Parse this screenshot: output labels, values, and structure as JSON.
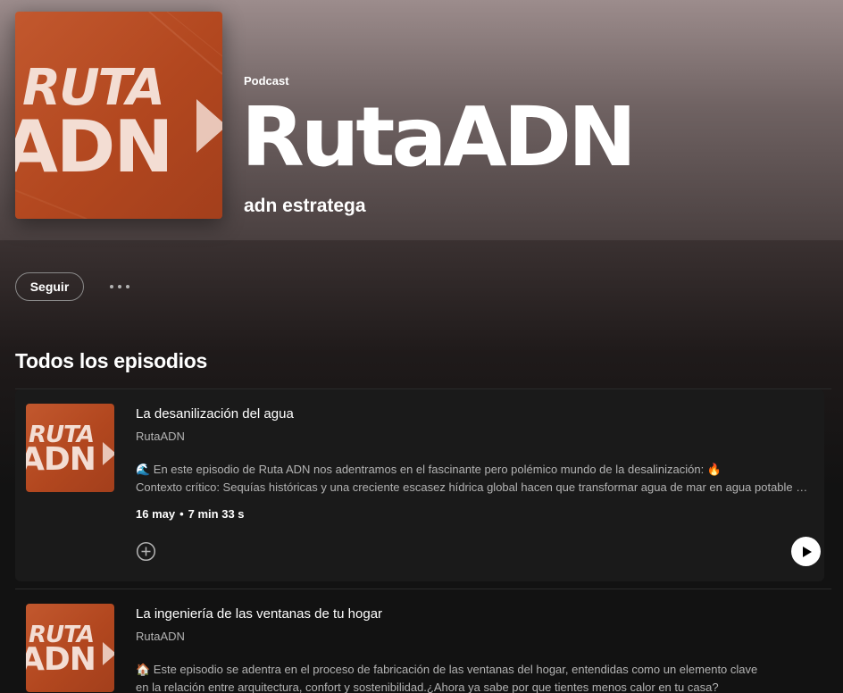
{
  "podcast": {
    "type_label": "Podcast",
    "title": "RutaADN",
    "author": "adn estratega",
    "cover": {
      "line1": "RUTA",
      "line2": "ADN",
      "bg_color": "#b84a22",
      "text_color": "#f3ddd3"
    }
  },
  "actions": {
    "follow_label": "Seguir",
    "more_icon": "more-horizontal-icon"
  },
  "section": {
    "title": "Todos los episodios"
  },
  "episodes": [
    {
      "title": "La desanilización del agua",
      "show": "RutaADN",
      "desc_line1": "🌊 En este episodio de Ruta ADN nos adentramos en el fascinante pero polémico mundo de la desalinización: 🔥",
      "desc_line2": "Contexto crítico: Sequías históricas y una creciente escasez hídrica global hacen que transformar agua de mar en agua potable sea una necesidad",
      "date": "16 may",
      "separator": "•",
      "duration": "7 min 33 s",
      "add_icon": "add-circle-icon",
      "play_icon": "play-icon"
    },
    {
      "title": "La ingeniería de las ventanas de tu hogar",
      "show": "RutaADN",
      "desc_line1": "🏠 Este episodio se adentra en el proceso de fabricación de las ventanas del hogar, entendidas como un elemento clave",
      "desc_line2": "en la relación entre arquitectura, confort y sostenibilidad.¿Ahora ya sabe por que tientes menos calor en tu casa?"
    }
  ],
  "colors": {
    "background": "#121212",
    "hero_top": "#9c8c8c",
    "text_secondary": "#b3b3b3"
  }
}
